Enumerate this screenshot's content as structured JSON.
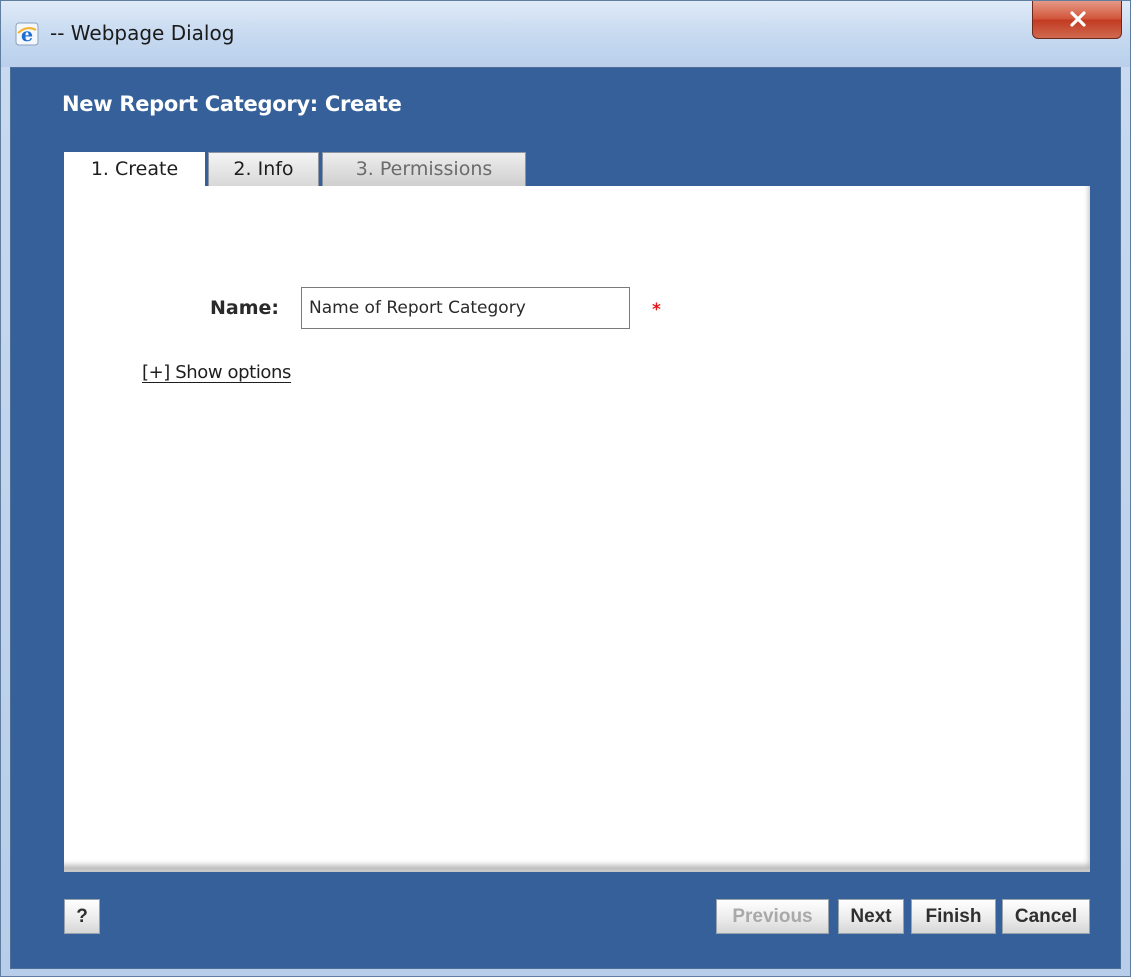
{
  "window": {
    "title": "-- Webpage Dialog",
    "icon": "ie-icon",
    "close_icon": "close-icon"
  },
  "dialog": {
    "heading": "New Report Category: Create",
    "tabs": [
      {
        "label": "1. Create",
        "active": true
      },
      {
        "label": "2. Info",
        "active": false
      },
      {
        "label": "3. Permissions",
        "active": false,
        "disabled": true
      }
    ]
  },
  "form": {
    "name_label": "Name:",
    "name_value": "Name of Report Category",
    "required_marker": "*",
    "show_options": "[+] Show options"
  },
  "footer": {
    "help_label": "?",
    "previous_label": "Previous",
    "next_label": "Next",
    "finish_label": "Finish",
    "cancel_label": "Cancel"
  },
  "colors": {
    "dialog_background": "#35609a",
    "required": "#e01a1a",
    "close_button": "#c13b22"
  }
}
